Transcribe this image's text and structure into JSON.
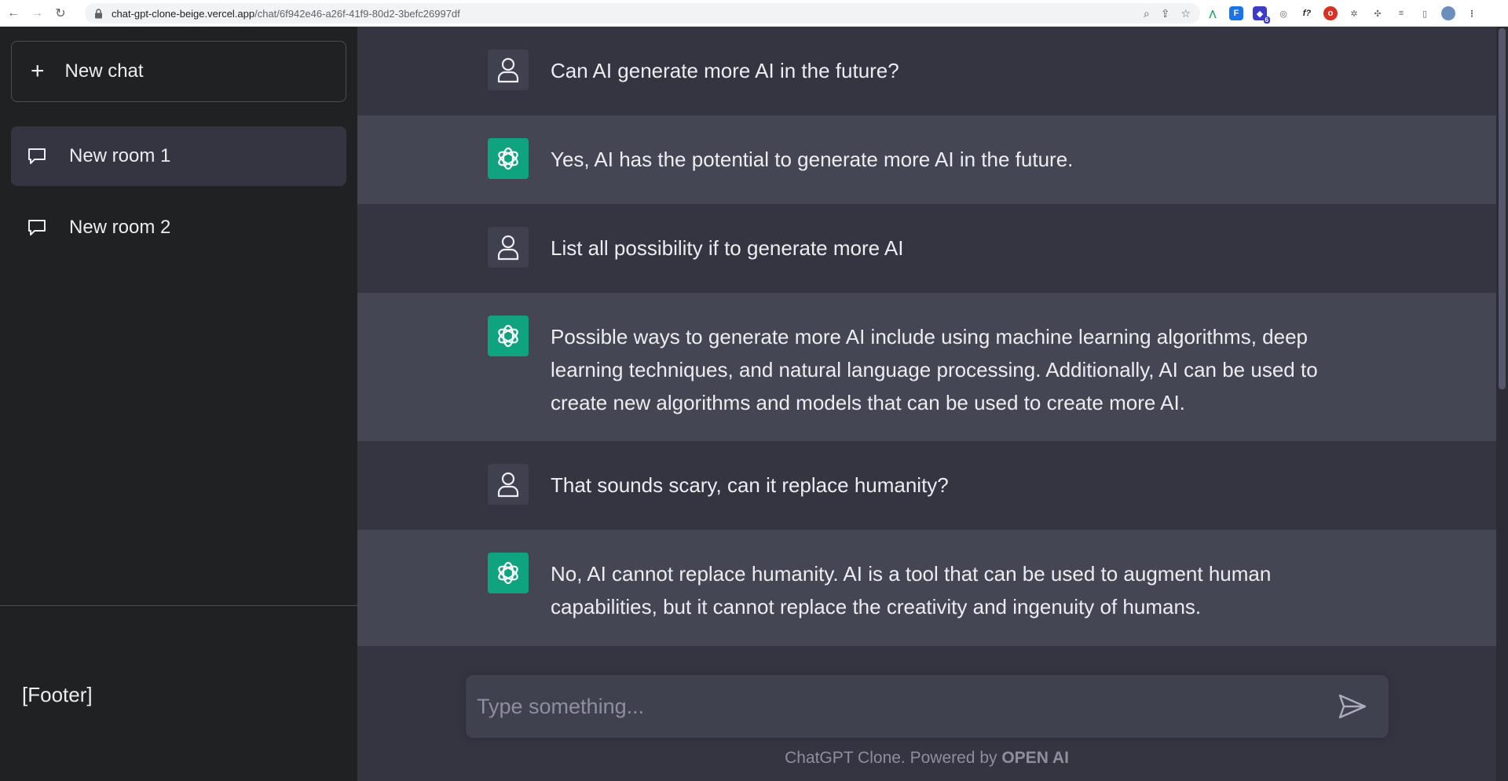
{
  "browser": {
    "url_host": "chat-gpt-clone-beige.vercel.app",
    "url_path": "/chat/6f942e46-a26f-41f9-80d2-3befc26997df",
    "extension_badge": "6"
  },
  "sidebar": {
    "new_chat_label": "New chat",
    "rooms": [
      {
        "label": "New room 1",
        "active": true
      },
      {
        "label": "New room 2",
        "active": false
      }
    ],
    "footer": "[Footer]"
  },
  "messages": [
    {
      "role": "user",
      "text": "Can AI generate more AI in the future?"
    },
    {
      "role": "ai",
      "text": "Yes, AI has the potential to generate more AI in the future."
    },
    {
      "role": "user",
      "text": "List all possibility if to generate more AI"
    },
    {
      "role": "ai",
      "text": "Possible ways to generate more AI include using machine learning algorithms, deep learning techniques, and natural language processing. Additionally, AI can be used to create new algorithms and models that can be used to create more AI."
    },
    {
      "role": "user",
      "text": "That sounds scary, can it replace humanity?"
    },
    {
      "role": "ai",
      "text": "No, AI cannot replace humanity. AI is a tool that can be used to augment human capabilities, but it cannot replace the creativity and ingenuity of humans."
    }
  ],
  "composer": {
    "placeholder": "Type something...",
    "value": ""
  },
  "powered_by": {
    "prefix": "ChatGPT Clone. Powered by ",
    "brand": "OPEN AI"
  },
  "colors": {
    "sidebar_bg": "#202123",
    "main_bg": "#343541",
    "ai_row_bg": "#444654",
    "ai_avatar": "#10a37f"
  }
}
